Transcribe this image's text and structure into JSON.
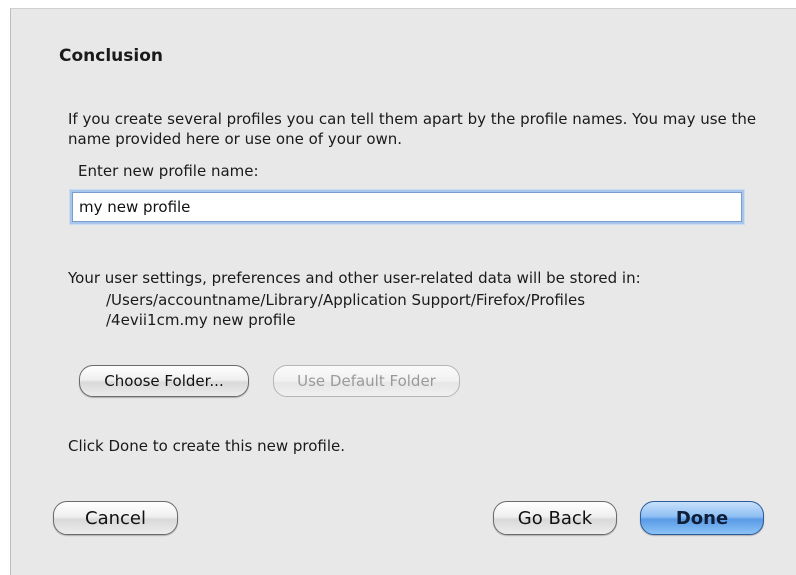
{
  "dialog": {
    "title": "Conclusion",
    "intro_text": "If you create several profiles you can tell them apart by the profile names. You may use the name provided here or use one of your own.",
    "name_label": "Enter new profile name:",
    "name_value": "my new profile",
    "storage_label": "Your user settings, preferences and other user-related data will be stored in:",
    "storage_path_line1": "/Users/accountname/Library/Application Support/Firefox/Profiles",
    "storage_path_line2": "/4evii1cm.my new profile",
    "choose_folder_label": "Choose Folder...",
    "use_default_label": "Use Default Folder",
    "done_hint": "Click Done to create this new profile.",
    "cancel_label": "Cancel",
    "go_back_label": "Go Back",
    "done_label": "Done"
  }
}
